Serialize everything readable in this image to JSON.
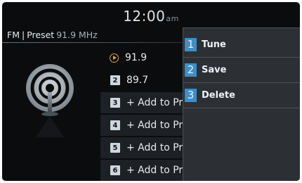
{
  "clock": {
    "time": "12:00",
    "ampm": "am"
  },
  "source": {
    "band": "FM",
    "separator": "|",
    "mode": "Preset",
    "frequency": "91.9 MHz"
  },
  "presets": [
    {
      "index": "",
      "label": "91.9",
      "playing": true
    },
    {
      "index": "2",
      "label": "89.7",
      "playing": false
    },
    {
      "index": "3",
      "label": "+ Add to Preset",
      "playing": false
    },
    {
      "index": "4",
      "label": "+ Add to Preset",
      "playing": false
    },
    {
      "index": "5",
      "label": "+ Add to Preset",
      "playing": false
    },
    {
      "index": "6",
      "label": "+ Add to Preset",
      "playing": false
    }
  ],
  "menu": [
    {
      "index": "1",
      "label": "Tune"
    },
    {
      "index": "2",
      "label": "Save"
    },
    {
      "index": "3",
      "label": "Delete"
    }
  ],
  "colors": {
    "accent": "#3d8fc8",
    "playing": "#e4a43a",
    "background": "#0a0c0e"
  }
}
